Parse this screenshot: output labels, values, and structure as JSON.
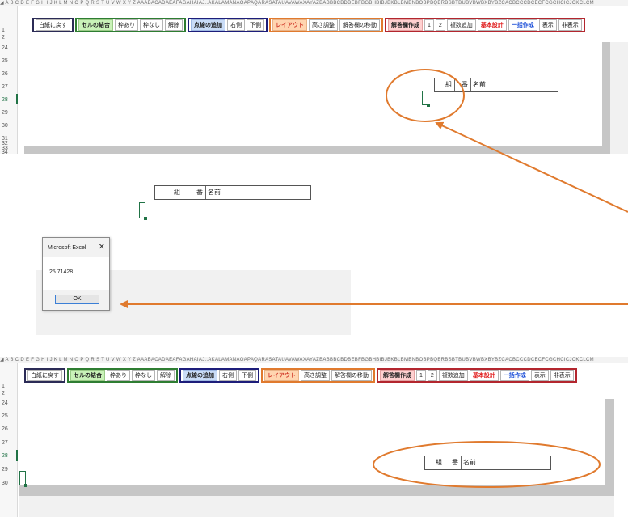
{
  "column_header_text": "◢ A B C D E F G H I J K L M N O P Q R S T U V W X Y Z AAABACADAEAFAGAHAIAJ..AKALAMANAOAPAQARASATAUAVAWAXAYAZBABBBCBDBEBFBGBHBIBJBKBLBMBNBOBPBQBRBSBTBUBVBWBXBYBZCACBCCCDCECFCGCHCICJCKCLCM",
  "ribbon": {
    "group1": [
      "白紙に戻す"
    ],
    "group2": [
      "セルの結合",
      "枠あり",
      "枠なし",
      "解除"
    ],
    "group3": [
      "点線の追加",
      "右側",
      "下側"
    ],
    "group4": [
      "レイアウト",
      "高さ調整",
      "解答欄の移動"
    ],
    "group5": [
      "解答欄作成",
      "1",
      "2",
      "複数追加",
      "基本設計",
      "一括作成",
      "表示",
      "非表示"
    ]
  },
  "panel_top": {
    "row_numbers": [
      "1",
      "2",
      "24",
      "25",
      "26",
      "27",
      "28",
      "29",
      "30",
      "31",
      "32",
      "33",
      "34",
      "35"
    ],
    "active_row": "28"
  },
  "panel_bottom": {
    "row_numbers": [
      "1",
      "2",
      "24",
      "25",
      "26",
      "27",
      "28",
      "29",
      "30"
    ],
    "active_row": "28"
  },
  "name_box": {
    "kumi": "組",
    "ban": "番",
    "namae": "名前"
  },
  "dialog": {
    "title": "Microsoft Excel",
    "close": "✕",
    "message": "25.71428",
    "ok": "OK"
  },
  "colors": {
    "annotation": "#e07a2e",
    "excel_green": "#217346"
  }
}
